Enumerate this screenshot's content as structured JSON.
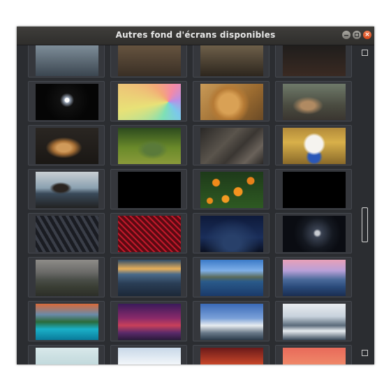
{
  "window": {
    "title": "Autres fond d'écrans disponibles",
    "minimize_icon": "minimize-icon",
    "maximize_icon": "maximize-icon",
    "close_icon": "close-icon",
    "close_glyph": "×"
  },
  "wallpapers": [
    {
      "name": "partial-top-1",
      "bg": "linear-gradient(#8a9aa6,#3b4650)"
    },
    {
      "name": "partial-top-2",
      "bg": "linear-gradient(#6d5a44,#3a2f25)"
    },
    {
      "name": "partial-top-3",
      "bg": "linear-gradient(#7a6a52,#2d261e)"
    },
    {
      "name": "partial-top-4",
      "bg": "linear-gradient(#1b1b1b,#3a2a22)"
    },
    {
      "name": "sparkle-on-black",
      "bg": "radial-gradient(circle at 50% 45%, #ffffff 0 3px, #9aa6b8 4px, #111 10px, #050505 60%)"
    },
    {
      "name": "rainbow-swirl",
      "bg": "conic-gradient(from 20deg at 80% 50%, #f38aa7, #b890e6, #7bc8ea, #7fe0b5, #e8e177, #f3a977, #f38aa7)"
    },
    {
      "name": "lion",
      "bg": "radial-gradient(circle at 45% 55%, #d9a155 0 14px, #b57a35 22px, transparent 30px), linear-gradient(135deg,#c99a57,#9b6b30 60%,#6a4a26)"
    },
    {
      "name": "lioness-resting",
      "bg": "radial-gradient(ellipse at 40% 60%, #b08a62 0 10px, transparent 22px), linear-gradient(#6f7a6a,#4a4b40 60%,#3a3630)"
    },
    {
      "name": "cougar-on-log",
      "bg": "radial-gradient(ellipse at 45% 55%, #d09a5a 0 10px, #a56e35 16px, transparent 26px), linear-gradient(#2a2622,#1a1714)"
    },
    {
      "name": "iguana-grass",
      "bg": "radial-gradient(ellipse at 55% 60%, #5a7a3a 0 12px, transparent 22px), linear-gradient(#2c4a1e,#6a8a2a 55%,#8a9a3a)"
    },
    {
      "name": "tree-bark-wood",
      "bg": "linear-gradient(135deg,#2a2826,#5a544c 40%,#3a3632 60%,#6a625a 80%,#2a2826)"
    },
    {
      "name": "white-dog-flowers",
      "bg": "radial-gradient(circle at 50% 45%, #f5f3ef 0 12px, transparent 16px), radial-gradient(circle at 50% 80%, #2a58b8 0 8px, transparent 12px), linear-gradient(#b28a3a,#d8b04a 40%,#8a6a2a)"
    },
    {
      "name": "pier-sunset",
      "bg": "radial-gradient(ellipse at 40% 45%, #2a2420 0 10px, transparent 16px), linear-gradient(#c9cfd3,#8aa0b0 45%,#3a4a5a 60%,#222)"
    },
    {
      "name": "black-1",
      "bg": "#000000"
    },
    {
      "name": "orange-tree",
      "bg": "radial-gradient(circle at 25% 30%, #f08a1a 0 5px, transparent 6px), radial-gradient(circle at 60% 55%, #f3931f 0 6px, transparent 7px), radial-gradient(circle at 80% 25%, #e8801a 0 5px, transparent 6px), radial-gradient(circle at 40% 75%, #f39a22 0 5px, transparent 6px), radial-gradient(circle at 15% 80%, #e88a1a 0 4px, transparent 5px), linear-gradient(#1e3a1a,#2e5a22)"
    },
    {
      "name": "black-2",
      "bg": "#000000"
    },
    {
      "name": "metro-train",
      "bg": "repeating-linear-gradient(60deg,#3a3e48 0 4px,#1a1c22 4px 9px), linear-gradient(#4a4e5a,#222)"
    },
    {
      "name": "red-web-sculpture",
      "bg": "repeating-linear-gradient(45deg,#c0182a 0 2px,#5a0a12 2px 6px), repeating-linear-gradient(-45deg,#d02030 0 2px,transparent 2px 7px), #3a0a10"
    },
    {
      "name": "blue-night-sky",
      "bg": "radial-gradient(ellipse at 50% 75%, #28406a 0 12px, transparent 40px), linear-gradient(#0e1a3a,#1a2e5a 60%,#0a1020)"
    },
    {
      "name": "moon-night",
      "bg": "radial-gradient(circle at 55% 48%, #c8ccd2 0 3px, #3a4252 6px, #141820 22px, #0a0c12 60%)"
    },
    {
      "name": "mountain-clouds",
      "bg": "linear-gradient(#8e8c88,#6a6a68 35%,#4a4e48 55%,#3a3e34 75%,#2c2e28)"
    },
    {
      "name": "sunset-hills",
      "bg": "linear-gradient(#2a4a6a,#e8b05a 25%,#4a6a8a 40%,#2a3e56 65%,#1c2838)"
    },
    {
      "name": "mountain-lake",
      "bg": "linear-gradient(#3a7ac8,#7fb0e8 30%,#5a6a5a 48%,#2a5a8a 60%,#1a3a6a)"
    },
    {
      "name": "fjord-dusk",
      "bg": "linear-gradient(#e8a0b8,#b8a0d8 30%,#4a6a9a 55%,#2a4a7a 75%,#1a2e52)"
    },
    {
      "name": "alpine-lake",
      "bg": "linear-gradient(#d86a3a,#6a8aa8 30%,#2a6a3a 50%,#1ab0c8 70%,#0a7a9a)"
    },
    {
      "name": "purple-dusk",
      "bg": "linear-gradient(#3a1a5a,#8a2a6a 40%,#c8405a 60%,#5a2a6a 80%,#2a1a3a)"
    },
    {
      "name": "snowy-peaks",
      "bg": "linear-gradient(#3a6ab8,#7aa0d8 40%,#e8ecf0 60%,#6a7a8a 80%,#2a3a4a)"
    },
    {
      "name": "snowy-range",
      "bg": "linear-gradient(#e8ecf0,#c8d2dc 35%,#5a6a7a 60%,#e8ecf0 75%,#3a4a5a)"
    },
    {
      "name": "partial-bottom-1",
      "bg": "linear-gradient(#d8e8ea,#a8c8cc)"
    },
    {
      "name": "partial-bottom-2",
      "bg": "linear-gradient(#c8d8e8,#ffffff 60%,#8aa0b8)"
    },
    {
      "name": "partial-bottom-3",
      "bg": "linear-gradient(#6a1a1a,#d04a2a 50%,#3a1a1a)"
    },
    {
      "name": "partial-bottom-4",
      "bg": "linear-gradient(#e86a5a,#f08a6a 50%,#e8b0a0)"
    }
  ]
}
